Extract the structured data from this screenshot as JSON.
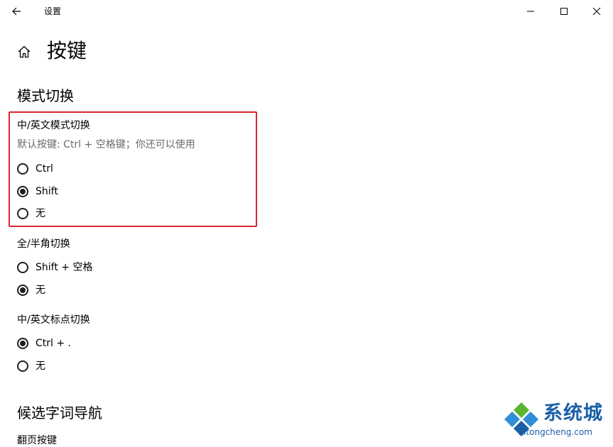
{
  "window": {
    "title": "设置",
    "controls": [
      "minimize",
      "maximize",
      "close"
    ]
  },
  "header": {
    "title": "按键"
  },
  "section_mode": {
    "title": "模式切换",
    "groups": [
      {
        "title": "中/英文模式切换",
        "hint": "默认按键: Ctrl + 空格键；你还可以使用",
        "options": [
          {
            "label": "Ctrl",
            "checked": false
          },
          {
            "label": "Shift",
            "checked": true
          },
          {
            "label": "无",
            "checked": false
          }
        ]
      },
      {
        "title": "全/半角切换",
        "options": [
          {
            "label": "Shift + 空格",
            "checked": false
          },
          {
            "label": "无",
            "checked": true
          }
        ]
      },
      {
        "title": "中/英文标点切换",
        "options": [
          {
            "label": "Ctrl + .",
            "checked": true
          },
          {
            "label": "无",
            "checked": false
          }
        ]
      }
    ]
  },
  "section_candidate": {
    "title": "候选字词导航",
    "next_label_partial": "翻页按键"
  },
  "watermark": {
    "name": "系统城",
    "url": "xitongcheng.com"
  },
  "colors": {
    "highlight": "#d9262e",
    "hint_text": "#6b6b6b",
    "watermark_blue": "#1b5fa8",
    "watermark_green": "#5cb531"
  }
}
